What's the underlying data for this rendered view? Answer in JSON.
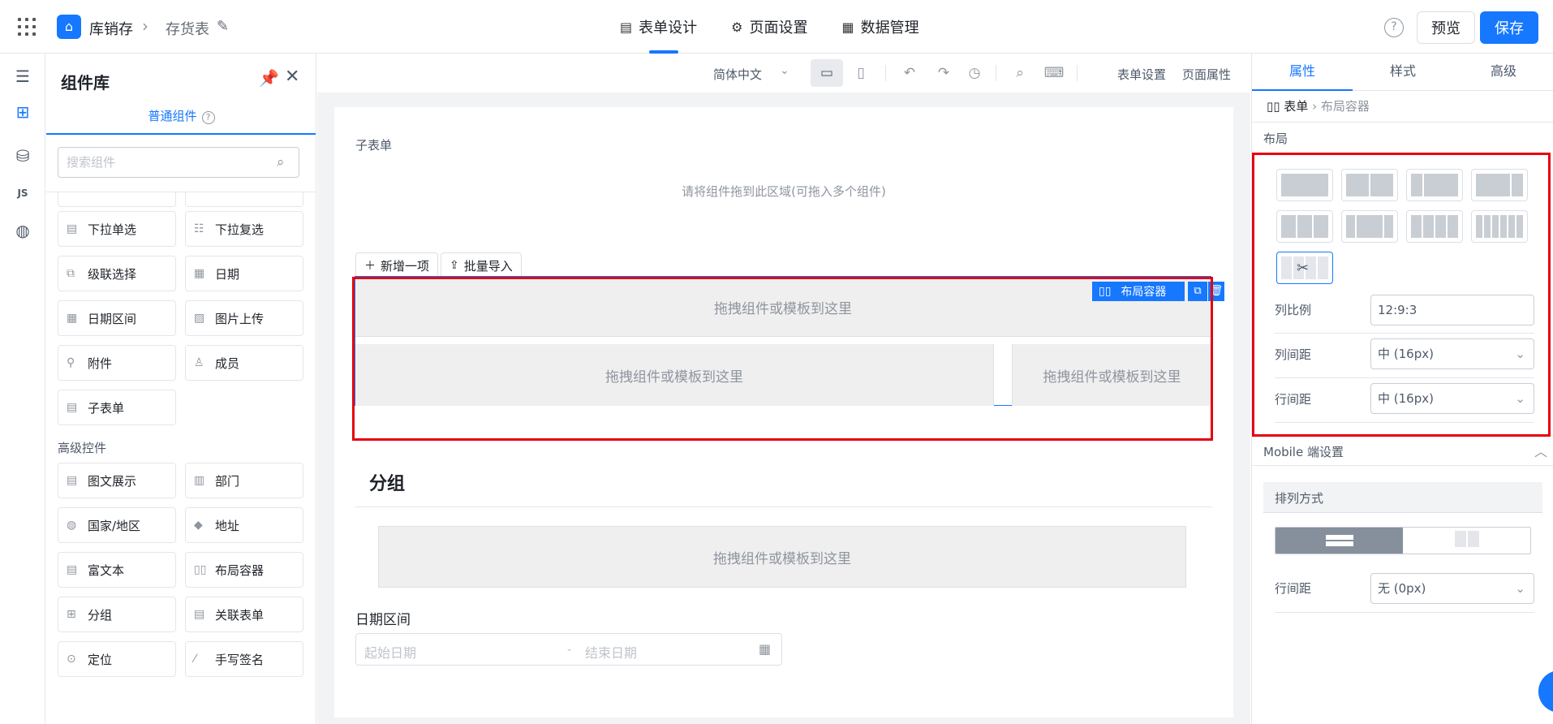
{
  "topbar": {
    "app_name": "库销存",
    "page_name": "存货表",
    "tabs": [
      {
        "label": "表单设计",
        "icon": "document-icon"
      },
      {
        "label": "页面设置",
        "icon": "gear-icon"
      },
      {
        "label": "数据管理",
        "icon": "table-icon"
      }
    ],
    "preview_label": "预览",
    "save_label": "保存",
    "accent": "#1677ff"
  },
  "library": {
    "title": "组件库",
    "tab_label": "普通组件",
    "search_placeholder": "搜索组件",
    "top_partial": [
      "",
      ""
    ],
    "basic": [
      "下拉单选",
      "下拉复选",
      "级联选择",
      "日期",
      "日期区间",
      "图片上传",
      "附件",
      "成员",
      "子表单"
    ],
    "advanced_title": "高级控件",
    "advanced": [
      "图文展示",
      "部门",
      "国家/地区",
      "地址",
      "富文本",
      "布局容器",
      "分组",
      "关联表单",
      "定位",
      "手写签名"
    ]
  },
  "canvas_toolbar": {
    "language": "简体中文",
    "form_settings": "表单设置",
    "page_props": "页面属性"
  },
  "canvas": {
    "subform_title": "子表单",
    "subform_hint": "请将组件拖到此区域(可拖入多个组件)",
    "add_item": "新增一项",
    "batch_import": "批量导入",
    "layout_tag": "布局容器",
    "drop_text": "拖拽组件或模板到这里",
    "group_title": "分组",
    "date_label": "日期区间",
    "date_start": "起始日期",
    "date_dash": "-",
    "date_end": "结束日期"
  },
  "props": {
    "tabs": [
      "属性",
      "样式",
      "高级"
    ],
    "crumb_root": "表单",
    "crumb_current": "布局容器",
    "layout_label": "布局",
    "ratio_label": "列比例",
    "ratio_value": "12:9:3",
    "col_gap_label": "列间距",
    "col_gap_value": "中 (16px)",
    "row_gap_label": "行间距",
    "row_gap_value": "中 (16px)",
    "mobile_title": "Mobile 端设置",
    "arrange_label": "排列方式",
    "mobile_row_gap_label": "行间距",
    "mobile_row_gap_value": "无 (0px)"
  }
}
